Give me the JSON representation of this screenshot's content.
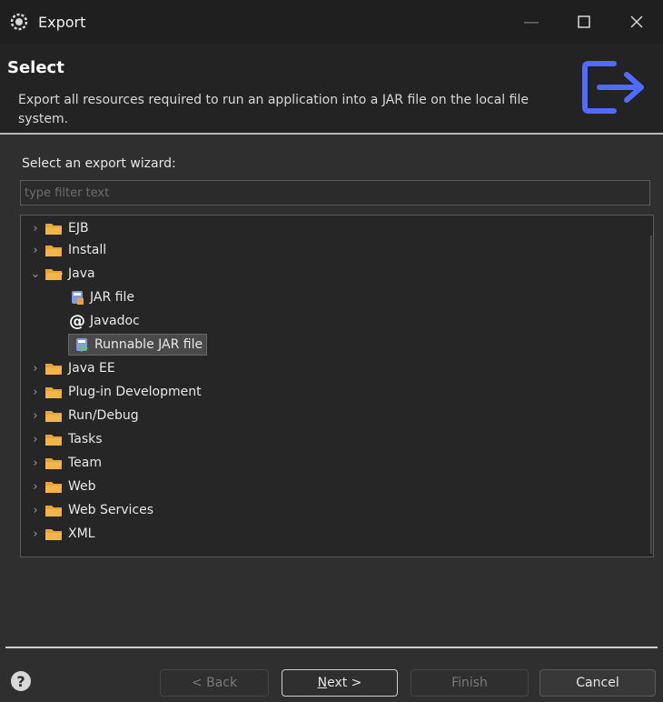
{
  "window": {
    "title": "Export",
    "icon": "eclipse-gear-icon",
    "controls": [
      "minimize-icon",
      "maximize-icon",
      "close-icon"
    ]
  },
  "header": {
    "title": "Select",
    "description": "Export all resources required to run an application into a JAR file on the local file system.",
    "icon": "export-arrow-icon",
    "icon_color": "#4f6cff"
  },
  "wizard": {
    "label": "Select an export wizard:",
    "filter_placeholder": "type filter text",
    "filter_value": ""
  },
  "tree": {
    "items": [
      {
        "label": "EJB",
        "expanded": false
      },
      {
        "label": "Install",
        "expanded": false
      },
      {
        "label": "Java",
        "expanded": true
      },
      {
        "label": "JAR file",
        "child": true,
        "icon": "jar-file-icon"
      },
      {
        "label": "Javadoc",
        "child": true,
        "icon": "javadoc-at-icon"
      },
      {
        "label": "Runnable JAR file",
        "child": true,
        "icon": "runnable-jar-icon",
        "selected": true
      },
      {
        "label": "Java EE",
        "expanded": false
      },
      {
        "label": "Plug-in Development",
        "expanded": false
      },
      {
        "label": "Run/Debug",
        "expanded": false
      },
      {
        "label": "Tasks",
        "expanded": false
      },
      {
        "label": "Team",
        "expanded": false
      },
      {
        "label": "Web",
        "expanded": false
      },
      {
        "label": "Web Services",
        "expanded": false
      },
      {
        "label": "XML",
        "expanded": false
      }
    ]
  },
  "buttons": {
    "help_glyph": "?",
    "back": "< Back",
    "next_mnemonic": "N",
    "next_rest": "ext >",
    "finish": "Finish",
    "cancel": "Cancel"
  },
  "colors": {
    "folder": "#e8a33b",
    "accent": "#4f6cff"
  }
}
